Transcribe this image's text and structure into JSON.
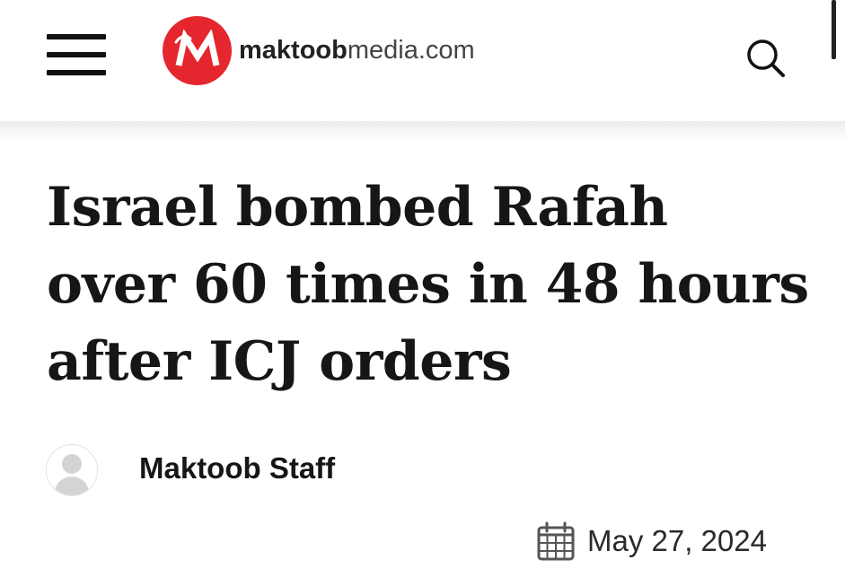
{
  "header": {
    "logo_bold": "maktoob",
    "logo_light": "media.com",
    "logo_mark_letter": "M",
    "menu_icon": "hamburger-menu-icon",
    "search_icon": "search-icon",
    "brand_color": "#e5262e"
  },
  "article": {
    "headline": "Israel bombed Rafah over 60 times in 48 hours after ICJ orders",
    "author": "Maktoob Staff",
    "date": "May 27, 2024",
    "avatar_icon": "default-avatar-icon",
    "date_icon": "calendar-icon"
  }
}
